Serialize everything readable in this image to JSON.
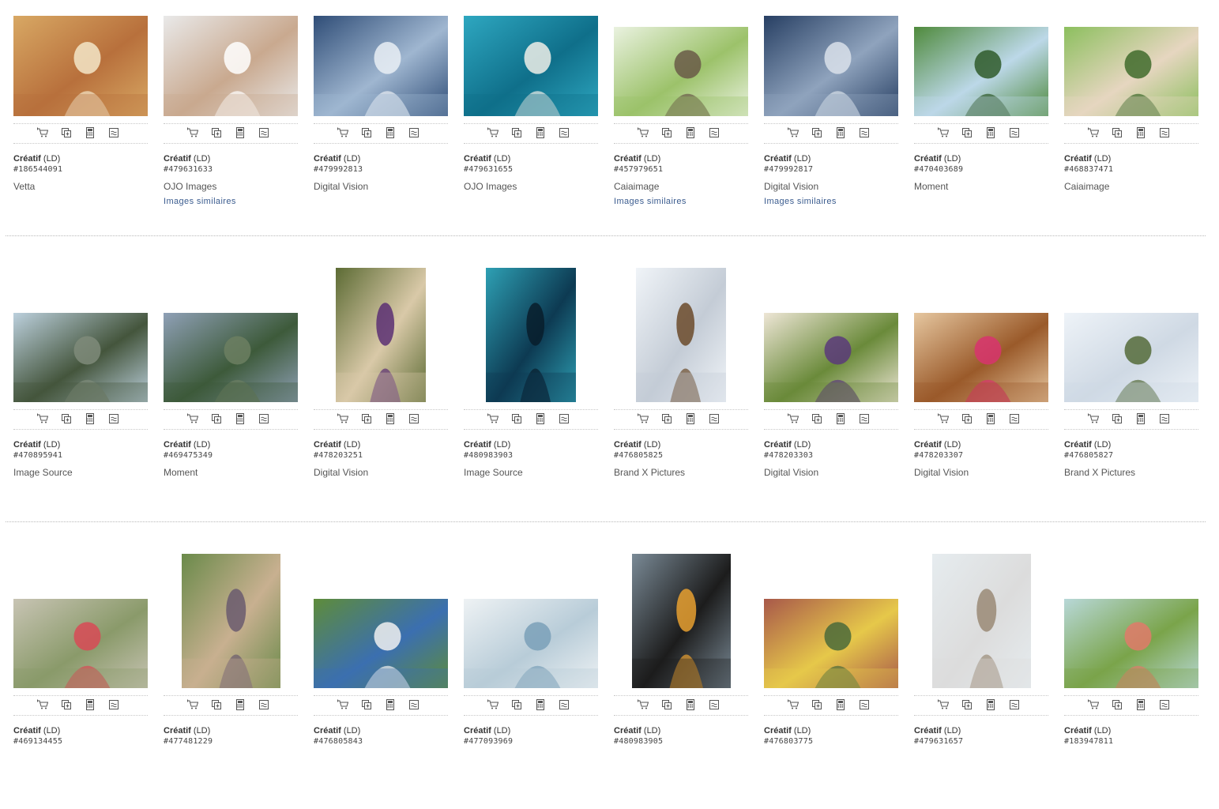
{
  "ui": {
    "license_bold": "Créatif",
    "license_suffix": "(LD)",
    "similar_label": "Images similaires"
  },
  "icons": [
    "add-to-cart-icon",
    "add-to-lightbox-icon",
    "price-calculator-icon",
    "similar-images-icon"
  ],
  "rows": [
    {
      "items": [
        {
          "id": "#186544091",
          "collection": "Vetta",
          "similar": false,
          "colors": [
            "#d8a864",
            "#b8703c",
            "#f3e6c8"
          ],
          "orient": "landscape"
        },
        {
          "id": "#479631633",
          "collection": "OJO Images",
          "similar": true,
          "colors": [
            "#e9e9e9",
            "#c9a98f",
            "#ffffff"
          ],
          "orient": "landscape"
        },
        {
          "id": "#479992813",
          "collection": "Digital Vision",
          "similar": false,
          "colors": [
            "#2f4d77",
            "#9fb6d0",
            "#e9eef4"
          ],
          "orient": "landscape"
        },
        {
          "id": "#479631655",
          "collection": "OJO Images",
          "similar": false,
          "colors": [
            "#2ea7c0",
            "#0f6f8a",
            "#efeee8"
          ],
          "orient": "landscape"
        },
        {
          "id": "#457979651",
          "collection": "Caiaimage",
          "similar": true,
          "colors": [
            "#eaf2e0",
            "#9cc26a",
            "#6a5a48"
          ],
          "orient": "landscape-short"
        },
        {
          "id": "#479992817",
          "collection": "Digital Vision",
          "similar": true,
          "colors": [
            "#273f63",
            "#8fa3bd",
            "#d9e1ea"
          ],
          "orient": "landscape"
        },
        {
          "id": "#470403689",
          "collection": "Moment",
          "similar": false,
          "colors": [
            "#4f8a3c",
            "#bcd8e8",
            "#2f5a2a"
          ],
          "orient": "landscape-short"
        },
        {
          "id": "#468837471",
          "collection": "Caiaimage",
          "similar": false,
          "colors": [
            "#8cbf5e",
            "#e6d6c0",
            "#3f6b2c"
          ],
          "orient": "landscape-short"
        }
      ]
    },
    {
      "items": [
        {
          "id": "#470895941",
          "collection": "Image Source",
          "similar": false,
          "colors": [
            "#bcd0dd",
            "#44553c",
            "#7f8b7a"
          ],
          "orient": "landscape-short"
        },
        {
          "id": "#469475349",
          "collection": "Moment",
          "similar": false,
          "colors": [
            "#8fa0b6",
            "#3d5a3a",
            "#6c7f62"
          ],
          "orient": "landscape-short"
        },
        {
          "id": "#478203251",
          "collection": "Digital Vision",
          "similar": false,
          "colors": [
            "#5c6b34",
            "#d9c9a8",
            "#5b2f73"
          ],
          "orient": "portrait"
        },
        {
          "id": "#480983903",
          "collection": "Image Source",
          "similar": false,
          "colors": [
            "#2ea0b4",
            "#0d3a52",
            "#081d2c"
          ],
          "orient": "portrait"
        },
        {
          "id": "#476805825",
          "collection": "Brand X Pictures",
          "similar": false,
          "colors": [
            "#f0f4f8",
            "#c4ccd6",
            "#6b4a2a"
          ],
          "orient": "portrait"
        },
        {
          "id": "#478203303",
          "collection": "Digital Vision",
          "similar": false,
          "colors": [
            "#eee6d6",
            "#6a8a3a",
            "#5b3a7a"
          ],
          "orient": "landscape-short"
        },
        {
          "id": "#478203307",
          "collection": "Digital Vision",
          "similar": false,
          "colors": [
            "#e6c7a0",
            "#9a5a2a",
            "#d8346e"
          ],
          "orient": "landscape-short"
        },
        {
          "id": "#476805827",
          "collection": "Brand X Pictures",
          "similar": false,
          "colors": [
            "#eef3f8",
            "#cfd9e4",
            "#556b3a"
          ],
          "orient": "landscape-short"
        }
      ]
    },
    {
      "items": [
        {
          "id": "#469134455",
          "collection": "",
          "similar": false,
          "colors": [
            "#c8c4b4",
            "#8a9a6a",
            "#d84a56"
          ],
          "orient": "landscape-short"
        },
        {
          "id": "#477481229",
          "collection": "",
          "similar": false,
          "colors": [
            "#6a8a4a",
            "#c8b090",
            "#6a5a6e"
          ],
          "orient": "portrait"
        },
        {
          "id": "#476805843",
          "collection": "",
          "similar": false,
          "colors": [
            "#5e8c3a",
            "#3b6fb0",
            "#f0f0f0"
          ],
          "orient": "landscape-short"
        },
        {
          "id": "#477093969",
          "collection": "",
          "similar": false,
          "colors": [
            "#eef2f4",
            "#b8ccd8",
            "#7aa0b8"
          ],
          "orient": "landscape-short"
        },
        {
          "id": "#480983905",
          "collection": "",
          "similar": false,
          "colors": [
            "#7a8a96",
            "#1c1c1c",
            "#e8a030"
          ],
          "orient": "portrait"
        },
        {
          "id": "#476803775",
          "collection": "",
          "similar": false,
          "colors": [
            "#a8584a",
            "#e6c84a",
            "#4a6a3a"
          ],
          "orient": "landscape-short"
        },
        {
          "id": "#479631657",
          "collection": "",
          "similar": false,
          "colors": [
            "#e6ecef",
            "#dcdcdc",
            "#9a8a76"
          ],
          "orient": "portrait"
        },
        {
          "id": "#183947811",
          "collection": "",
          "similar": false,
          "colors": [
            "#b8d8d8",
            "#7aa44a",
            "#e07a6a"
          ],
          "orient": "landscape-short"
        }
      ]
    }
  ]
}
